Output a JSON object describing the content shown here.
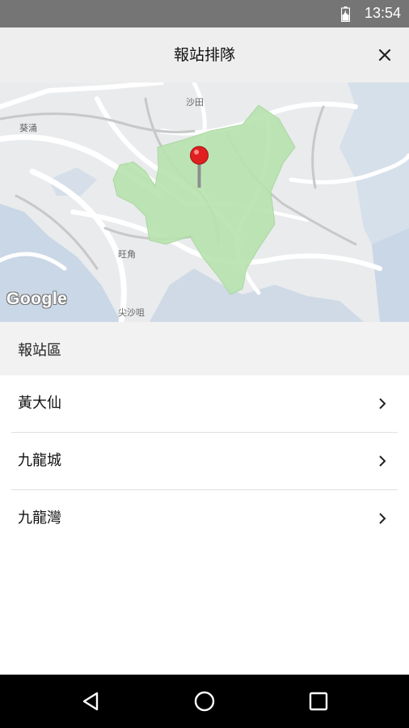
{
  "status_bar": {
    "time": "13:54",
    "battery_icon": "battery-charging-icon"
  },
  "app_bar": {
    "title": "報站排隊",
    "close_icon": "close-icon"
  },
  "map": {
    "labels": {
      "shatin": "沙田",
      "kwaichung": "葵涌",
      "mongkok": "旺角",
      "tsimshatsui": "尖沙咀"
    },
    "attribution": "Google",
    "highlight_color": "#b9e3b0",
    "marker_color": "#e02020"
  },
  "section": {
    "header": "報站區"
  },
  "districts": [
    {
      "label": "黃大仙"
    },
    {
      "label": "九龍城"
    },
    {
      "label": "九龍灣"
    }
  ],
  "nav_bar": {
    "back": "back-icon",
    "home": "home-icon",
    "recents": "recents-icon"
  }
}
